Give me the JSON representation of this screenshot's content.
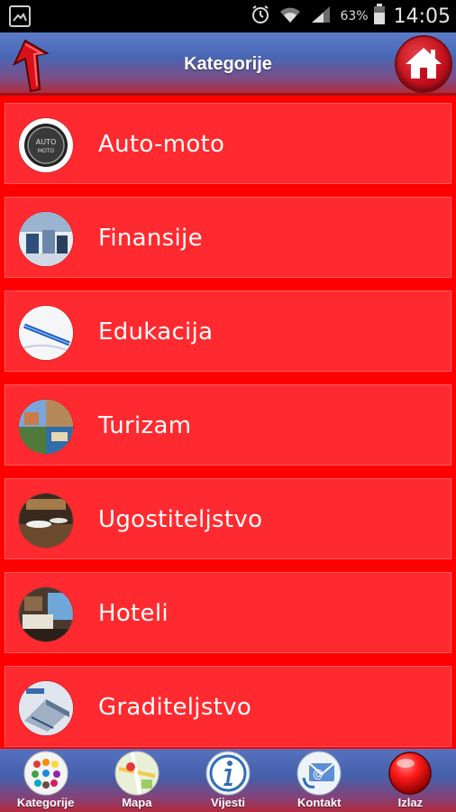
{
  "status_bar": {
    "battery_percent": "63%",
    "time": "14:05",
    "icons": [
      "image-icon",
      "alarm-icon",
      "wifi-icon",
      "signal-icon",
      "battery-icon"
    ]
  },
  "header": {
    "title": "Kategorije",
    "back_icon": "back-arrow-icon",
    "home_icon": "home-icon",
    "gradient_top": "#5c7cc8",
    "gradient_bottom": "#b02d3c"
  },
  "categories": [
    {
      "label": "Auto-moto",
      "icon": "auto-moto-icon"
    },
    {
      "label": "Finansije",
      "icon": "finance-icon"
    },
    {
      "label": "Edukacija",
      "icon": "education-icon"
    },
    {
      "label": "Turizam",
      "icon": "tourism-icon"
    },
    {
      "label": "Ugostiteljstvo",
      "icon": "hospitality-icon"
    },
    {
      "label": "Hoteli",
      "icon": "hotel-icon"
    },
    {
      "label": "Graditeljstvo",
      "icon": "construction-icon"
    }
  ],
  "list_colors": {
    "background": "#ff0000",
    "item": "#ff2a2f"
  },
  "bottom_nav": [
    {
      "label": "Kategorije",
      "icon": "categories-icon"
    },
    {
      "label": "Mapa",
      "icon": "map-icon"
    },
    {
      "label": "Vijesti",
      "icon": "info-icon"
    },
    {
      "label": "Kontakt",
      "icon": "contact-icon"
    },
    {
      "label": "Izlaz",
      "icon": "exit-icon"
    }
  ]
}
